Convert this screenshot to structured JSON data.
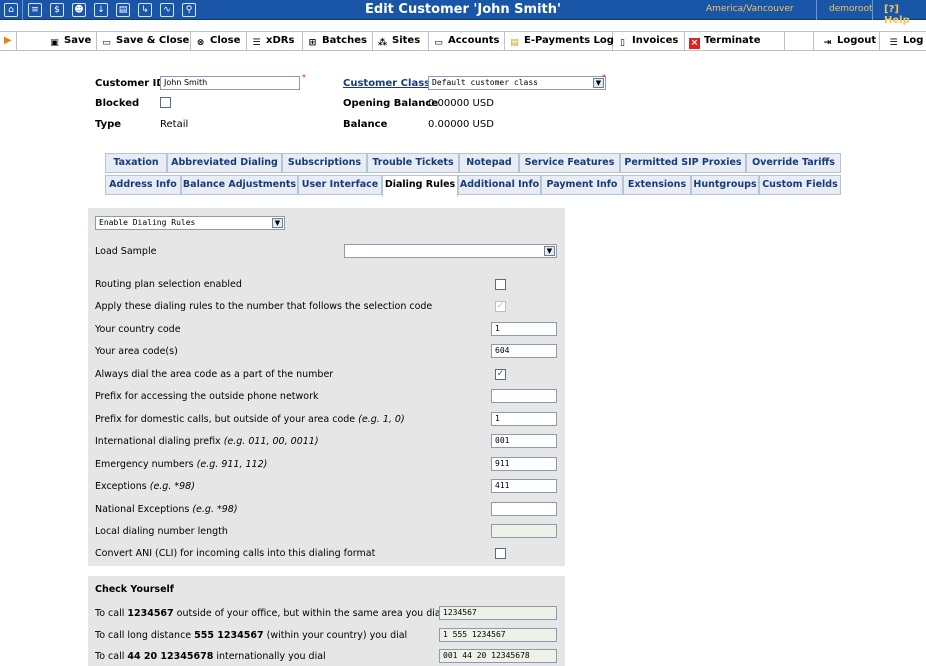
{
  "topbar": {
    "title": "Edit Customer 'John Smith'",
    "timezone": "America/Vancouver",
    "user": "demoroot",
    "help": "Help",
    "icons": [
      "home-icon",
      "list-icon",
      "billing-icon",
      "users-icon",
      "import-icon",
      "tariff-icon",
      "forward-icon",
      "chart-icon",
      "search-icon"
    ]
  },
  "toolbar": {
    "save": "Save",
    "save_close": "Save & Close",
    "close": "Close",
    "xdrs": "xDRs",
    "batches": "Batches",
    "sites": "Sites",
    "accounts": "Accounts",
    "epayments": "E-Payments Log",
    "invoices": "Invoices",
    "terminate": "Terminate",
    "logout": "Logout",
    "log": "Log"
  },
  "customer": {
    "id_label": "Customer ID",
    "id_value": "John Smith",
    "blocked_label": "Blocked",
    "type_label": "Type",
    "type_value": "Retail",
    "class_label": "Customer Class",
    "class_value": "Default customer class",
    "opening_balance_label": "Opening Balance",
    "opening_balance_value": "0.00000 USD",
    "balance_label": "Balance",
    "balance_value": "0.00000 USD",
    "required_mark": "*"
  },
  "tabs_row1": [
    "Taxation",
    "Abbreviated Dialing",
    "Subscriptions",
    "Trouble Tickets",
    "Notepad",
    "Service Features",
    "Permitted SIP Proxies",
    "Override Tariffs"
  ],
  "tabs_row2": [
    "Address Info",
    "Balance Adjustments",
    "User Interface",
    "Dialing Rules",
    "Additional Info",
    "Payment Info",
    "Extensions",
    "Huntgroups",
    "Custom Fields"
  ],
  "dialing": {
    "mode": "Enable Dialing Rules",
    "load_sample_label": "Load Sample",
    "load_sample_value": "",
    "routing_label": "Routing plan selection enabled",
    "apply_label": "Apply these dialing rules to the number that follows the selection code",
    "country_code_label": "Your country code",
    "country_code_value": "1",
    "area_codes_label": "Your area code(s)",
    "area_codes_value": "604",
    "always_dial_label": "Always dial the area code as a part of the number",
    "outside_prefix_label": "Prefix for accessing the outside phone network",
    "outside_prefix_value": "",
    "domestic_prefix_label": "Prefix for domestic calls, but outside of your area code",
    "domestic_prefix_hint": "(e.g. 1, 0)",
    "domestic_prefix_value": "1",
    "intl_prefix_label": "International dialing prefix",
    "intl_prefix_hint": "(e.g. 011, 00, 0011)",
    "intl_prefix_value": "001",
    "emergency_label": "Emergency numbers",
    "emergency_hint": "(e.g. 911, 112)",
    "emergency_value": "911",
    "exceptions_label": "Exceptions",
    "exceptions_hint": "(e.g. *98)",
    "exceptions_value": "411",
    "national_exc_label": "National Exceptions",
    "national_exc_hint": "(e.g. *98)",
    "national_exc_value": "",
    "local_len_label": "Local dialing number length",
    "local_len_value": "",
    "convert_ani_label": "Convert ANI (CLI) for incoming calls into this dialing format"
  },
  "check": {
    "title": "Check Yourself",
    "r1_pre": "To call ",
    "r1_num": "1234567",
    "r1_post": " outside of your office, but within the same area you dial",
    "r1_value": "1234567",
    "r2_pre": "To call long distance ",
    "r2_num": "555 1234567",
    "r2_post": " (within your country) you dial",
    "r2_value": "1 555 1234567",
    "r3_pre": "To call ",
    "r3_num": "44 20 12345678",
    "r3_post": " internationally you dial",
    "r3_value": "001 44 20 12345678"
  },
  "glyphs": {
    "check": "✓",
    "arrow": "▼",
    "play": "▶"
  }
}
